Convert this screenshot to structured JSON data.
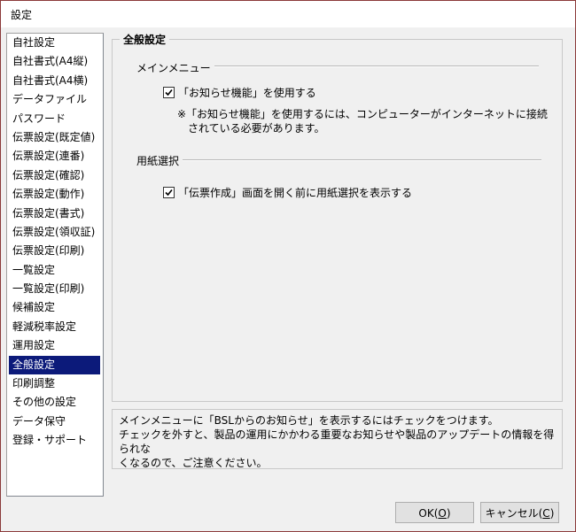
{
  "window": {
    "title": "設定"
  },
  "sidebar": {
    "items": [
      {
        "label": "自社設定"
      },
      {
        "label": "自社書式(A4縦)"
      },
      {
        "label": "自社書式(A4横)"
      },
      {
        "label": "データファイル"
      },
      {
        "label": "パスワード"
      },
      {
        "label": "伝票設定(既定値)"
      },
      {
        "label": "伝票設定(連番)"
      },
      {
        "label": "伝票設定(確認)"
      },
      {
        "label": "伝票設定(動作)"
      },
      {
        "label": "伝票設定(書式)"
      },
      {
        "label": "伝票設定(領収証)"
      },
      {
        "label": "伝票設定(印刷)"
      },
      {
        "label": "一覧設定"
      },
      {
        "label": "一覧設定(印刷)"
      },
      {
        "label": "候補設定"
      },
      {
        "label": "軽減税率設定"
      },
      {
        "label": "運用設定"
      },
      {
        "label": "全般設定"
      },
      {
        "label": "印刷調整"
      },
      {
        "label": "その他の設定"
      },
      {
        "label": "データ保守"
      },
      {
        "label": "登録・サポート"
      }
    ],
    "selected_index": 17
  },
  "panel": {
    "group_title": "全般設定",
    "main_menu": {
      "section_title": "メインメニュー",
      "checkbox_label": "「お知らせ機能」を使用する",
      "checked": true,
      "note_line1": "※「お知らせ機能」を使用するには、コンピューターがインターネットに接続",
      "note_line2": "されている必要があります。"
    },
    "paper": {
      "section_title": "用紙選択",
      "checkbox_label": "「伝票作成」画面を開く前に用紙選択を表示する",
      "checked": true
    }
  },
  "info": {
    "line1": "メインメニューに「BSLからのお知らせ」を表示するにはチェックをつけます。",
    "line2": "チェックを外すと、製品の運用にかかわる重要なお知らせや製品のアップデートの情報を得られな",
    "line3": "くなるので、ご注意ください。"
  },
  "buttons": {
    "ok_text": "OK(",
    "ok_key": "O",
    "ok_end": ")",
    "cancel_text": "キャンセル(",
    "cancel_key": "C",
    "cancel_end": ")"
  }
}
